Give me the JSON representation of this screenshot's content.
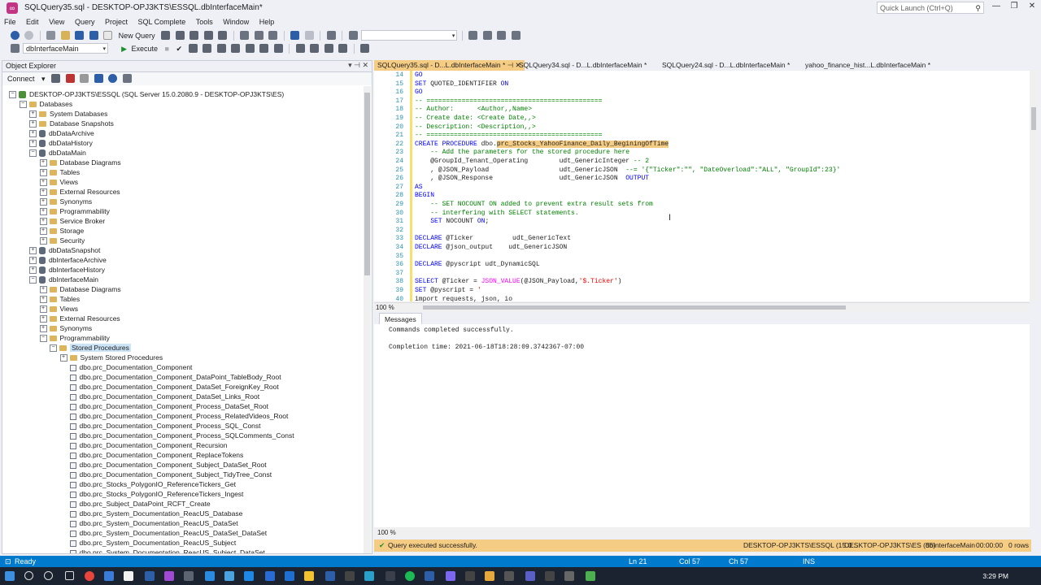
{
  "window": {
    "title": "SQLQuery35.sql - DESKTOP-OPJ3KTS\\ESSQL.dbInterfaceMain*",
    "quick_launch": "Quick Launch (Ctrl+Q)"
  },
  "menu": [
    "File",
    "Edit",
    "View",
    "Query",
    "Project",
    "SQL Complete",
    "Tools",
    "Window",
    "Help"
  ],
  "toolbar": {
    "new_query": "New Query",
    "database": "dbInterfaceMain",
    "execute": "Execute"
  },
  "object_explorer": {
    "title": "Object Explorer",
    "connect": "Connect",
    "tree": [
      {
        "label": "DESKTOP-OPJ3KTS\\ESSQL (SQL Server 15.0.2080.9 - DESKTOP-OPJ3KTS\\ES)",
        "level": 0,
        "expanded": true,
        "icon": "server-icon"
      },
      {
        "label": "Databases",
        "level": 1,
        "expanded": true,
        "icon": "folder-icon"
      },
      {
        "label": "System Databases",
        "level": 2,
        "expanded": false,
        "icon": "folder-icon"
      },
      {
        "label": "Database Snapshots",
        "level": 2,
        "expanded": false,
        "icon": "folder-icon"
      },
      {
        "label": "dbDataArchive",
        "level": 2,
        "expanded": false,
        "icon": "database-icon"
      },
      {
        "label": "dbDataHistory",
        "level": 2,
        "expanded": false,
        "icon": "database-icon"
      },
      {
        "label": "dbDataMain",
        "level": 2,
        "expanded": true,
        "icon": "database-icon"
      },
      {
        "label": "Database Diagrams",
        "level": 3,
        "expanded": false,
        "icon": "folder-icon"
      },
      {
        "label": "Tables",
        "level": 3,
        "expanded": false,
        "icon": "folder-icon"
      },
      {
        "label": "Views",
        "level": 3,
        "expanded": false,
        "icon": "folder-icon"
      },
      {
        "label": "External Resources",
        "level": 3,
        "expanded": false,
        "icon": "folder-icon"
      },
      {
        "label": "Synonyms",
        "level": 3,
        "expanded": false,
        "icon": "folder-icon"
      },
      {
        "label": "Programmability",
        "level": 3,
        "expanded": false,
        "icon": "folder-icon"
      },
      {
        "label": "Service Broker",
        "level": 3,
        "expanded": false,
        "icon": "folder-icon"
      },
      {
        "label": "Storage",
        "level": 3,
        "expanded": false,
        "icon": "folder-icon"
      },
      {
        "label": "Security",
        "level": 3,
        "expanded": false,
        "icon": "folder-icon"
      },
      {
        "label": "dbDataSnapshot",
        "level": 2,
        "expanded": false,
        "icon": "database-icon"
      },
      {
        "label": "dbInterfaceArchive",
        "level": 2,
        "expanded": false,
        "icon": "database-icon"
      },
      {
        "label": "dbInterfaceHistory",
        "level": 2,
        "expanded": false,
        "icon": "database-icon"
      },
      {
        "label": "dbInterfaceMain",
        "level": 2,
        "expanded": true,
        "icon": "database-icon"
      },
      {
        "label": "Database Diagrams",
        "level": 3,
        "expanded": false,
        "icon": "folder-icon"
      },
      {
        "label": "Tables",
        "level": 3,
        "expanded": false,
        "icon": "folder-icon"
      },
      {
        "label": "Views",
        "level": 3,
        "expanded": false,
        "icon": "folder-icon"
      },
      {
        "label": "External Resources",
        "level": 3,
        "expanded": false,
        "icon": "folder-icon"
      },
      {
        "label": "Synonyms",
        "level": 3,
        "expanded": false,
        "icon": "folder-icon"
      },
      {
        "label": "Programmability",
        "level": 3,
        "expanded": true,
        "icon": "folder-icon"
      },
      {
        "label": "Stored Procedures",
        "level": 4,
        "expanded": true,
        "icon": "folder-icon",
        "selected": true
      },
      {
        "label": "System Stored Procedures",
        "level": 5,
        "expanded": false,
        "icon": "folder-icon"
      },
      {
        "label": "dbo.prc_Documentation_Component",
        "level": 5,
        "expanded": false,
        "icon": "stored-procedure-icon"
      },
      {
        "label": "dbo.prc_Documentation_Component_DataPoint_TableBody_Root",
        "level": 5,
        "expanded": false,
        "icon": "stored-procedure-icon"
      },
      {
        "label": "dbo.prc_Documentation_Component_DataSet_ForeignKey_Root",
        "level": 5,
        "expanded": false,
        "icon": "stored-procedure-icon"
      },
      {
        "label": "dbo.prc_Documentation_Component_DataSet_Links_Root",
        "level": 5,
        "expanded": false,
        "icon": "stored-procedure-icon"
      },
      {
        "label": "dbo.prc_Documentation_Component_Process_DataSet_Root",
        "level": 5,
        "expanded": false,
        "icon": "stored-procedure-icon"
      },
      {
        "label": "dbo.prc_Documentation_Component_Process_RelatedVideos_Root",
        "level": 5,
        "expanded": false,
        "icon": "stored-procedure-icon"
      },
      {
        "label": "dbo.prc_Documentation_Component_Process_SQL_Const",
        "level": 5,
        "expanded": false,
        "icon": "stored-procedure-icon"
      },
      {
        "label": "dbo.prc_Documentation_Component_Process_SQLComments_Const",
        "level": 5,
        "expanded": false,
        "icon": "stored-procedure-icon"
      },
      {
        "label": "dbo.prc_Documentation_Component_Recursion",
        "level": 5,
        "expanded": false,
        "icon": "stored-procedure-icon"
      },
      {
        "label": "dbo.prc_Documentation_Component_ReplaceTokens",
        "level": 5,
        "expanded": false,
        "icon": "stored-procedure-icon"
      },
      {
        "label": "dbo.prc_Documentation_Component_Subject_DataSet_Root",
        "level": 5,
        "expanded": false,
        "icon": "stored-procedure-icon"
      },
      {
        "label": "dbo.prc_Documentation_Component_Subject_TidyTree_Const",
        "level": 5,
        "expanded": false,
        "icon": "stored-procedure-icon"
      },
      {
        "label": "dbo.prc_Stocks_PolygonIO_ReferenceTickers_Get",
        "level": 5,
        "expanded": false,
        "icon": "stored-procedure-icon"
      },
      {
        "label": "dbo.prc_Stocks_PolygonIO_ReferenceTickers_Ingest",
        "level": 5,
        "expanded": false,
        "icon": "stored-procedure-icon"
      },
      {
        "label": "dbo.prc_Subject_DataPoint_RCFT_Create",
        "level": 5,
        "expanded": false,
        "icon": "stored-procedure-icon"
      },
      {
        "label": "dbo.prc_System_Documentation_ReacUS_Database",
        "level": 5,
        "expanded": false,
        "icon": "stored-procedure-icon"
      },
      {
        "label": "dbo.prc_System_Documentation_ReacUS_DataSet",
        "level": 5,
        "expanded": false,
        "icon": "stored-procedure-icon"
      },
      {
        "label": "dbo.prc_System_Documentation_ReacUS_DataSet_DataSet",
        "level": 5,
        "expanded": false,
        "icon": "stored-procedure-icon"
      },
      {
        "label": "dbo.prc_System_Documentation_ReacUS_Subject",
        "level": 5,
        "expanded": false,
        "icon": "stored-procedure-icon"
      },
      {
        "label": "dbo.prc_System_Documentation_ReacUS_Subject_DataSet",
        "level": 5,
        "expanded": false,
        "icon": "stored-procedure-icon"
      }
    ]
  },
  "tabs": [
    {
      "label": "SQLQuery35.sql - D...L.dbInterfaceMain *",
      "active": true
    },
    {
      "label": "SQLQuery34.sql - D...L.dbInterfaceMain *",
      "active": false
    },
    {
      "label": "SQLQuery24.sql - D...L.dbInterfaceMain *",
      "active": false
    },
    {
      "label": "yahoo_finance_hist...L.dbInterfaceMain *",
      "active": false
    }
  ],
  "editor": {
    "zoom": "100 %",
    "lines": [
      {
        "n": "14",
        "text": "GO"
      },
      {
        "n": "15",
        "text": "SET QUOTED_IDENTIFIER ON"
      },
      {
        "n": "16",
        "text": "GO"
      },
      {
        "n": "17",
        "text": "-- ============================================="
      },
      {
        "n": "18",
        "text": "-- Author:      <Author,,Name>"
      },
      {
        "n": "19",
        "text": "-- Create date: <Create Date,,>"
      },
      {
        "n": "20",
        "text": "-- Description: <Description,,>"
      },
      {
        "n": "21",
        "text": "-- ============================================="
      },
      {
        "n": "22",
        "text": "CREATE PROCEDURE dbo.prc_Stocks_YahooFinance_Daily_BeginingOfTime"
      },
      {
        "n": "23",
        "text": "    -- Add the parameters for the stored procedure here"
      },
      {
        "n": "24",
        "text": "    @GroupId_Tenant_Operating        udt_GenericInteger -- 2"
      },
      {
        "n": "25",
        "text": "    , @JSON_Payload                  udt_GenericJSON  --= '{\"Ticker\":\"\", \"DateOverload\":\"ALL\", \"GroupId\":23}'"
      },
      {
        "n": "26",
        "text": "    , @JSON_Response                 udt_GenericJSON  OUTPUT"
      },
      {
        "n": "27",
        "text": "AS"
      },
      {
        "n": "28",
        "text": "BEGIN"
      },
      {
        "n": "29",
        "text": "    -- SET NOCOUNT ON added to prevent extra result sets from"
      },
      {
        "n": "30",
        "text": "    -- interfering with SELECT statements."
      },
      {
        "n": "31",
        "text": "    SET NOCOUNT ON;"
      },
      {
        "n": "32",
        "text": ""
      },
      {
        "n": "33",
        "text": "DECLARE @Ticker          udt_GenericText"
      },
      {
        "n": "34",
        "text": "DECLARE @json_output    udt_GenericJSON"
      },
      {
        "n": "35",
        "text": ""
      },
      {
        "n": "36",
        "text": "DECLARE @pyscript udt_DynamicSQL"
      },
      {
        "n": "37",
        "text": ""
      },
      {
        "n": "38",
        "text": "SELECT @Ticker = JSON_VALUE(@JSON_Payload,'$.Ticker')"
      },
      {
        "n": "39",
        "text": "SET @pyscript = '"
      },
      {
        "n": "40",
        "text": "import requests, json, io"
      }
    ]
  },
  "messages": {
    "tab": "Messages",
    "line1": "Commands completed successfully.",
    "line2": "Completion time: 2021-06-18T18:28:09.3742367-07:00",
    "zoom": "100 %"
  },
  "query_status": {
    "text": "Query executed successfully.",
    "server": "DESKTOP-OPJ3KTS\\ESSQL (15.0...",
    "user": "DESKTOP-OPJ3KTS\\ES (56)",
    "database": "dbInterfaceMain",
    "time": "00:00:00",
    "rows": "0 rows"
  },
  "statusbar": {
    "ready": "Ready",
    "ln": "Ln 21",
    "col": "Col 57",
    "ch": "Ch 57",
    "mode": "INS"
  },
  "taskbar": {
    "time": "3:29 PM"
  },
  "colors": {
    "accent": "#007acc",
    "active_tab": "#f5cc84"
  }
}
